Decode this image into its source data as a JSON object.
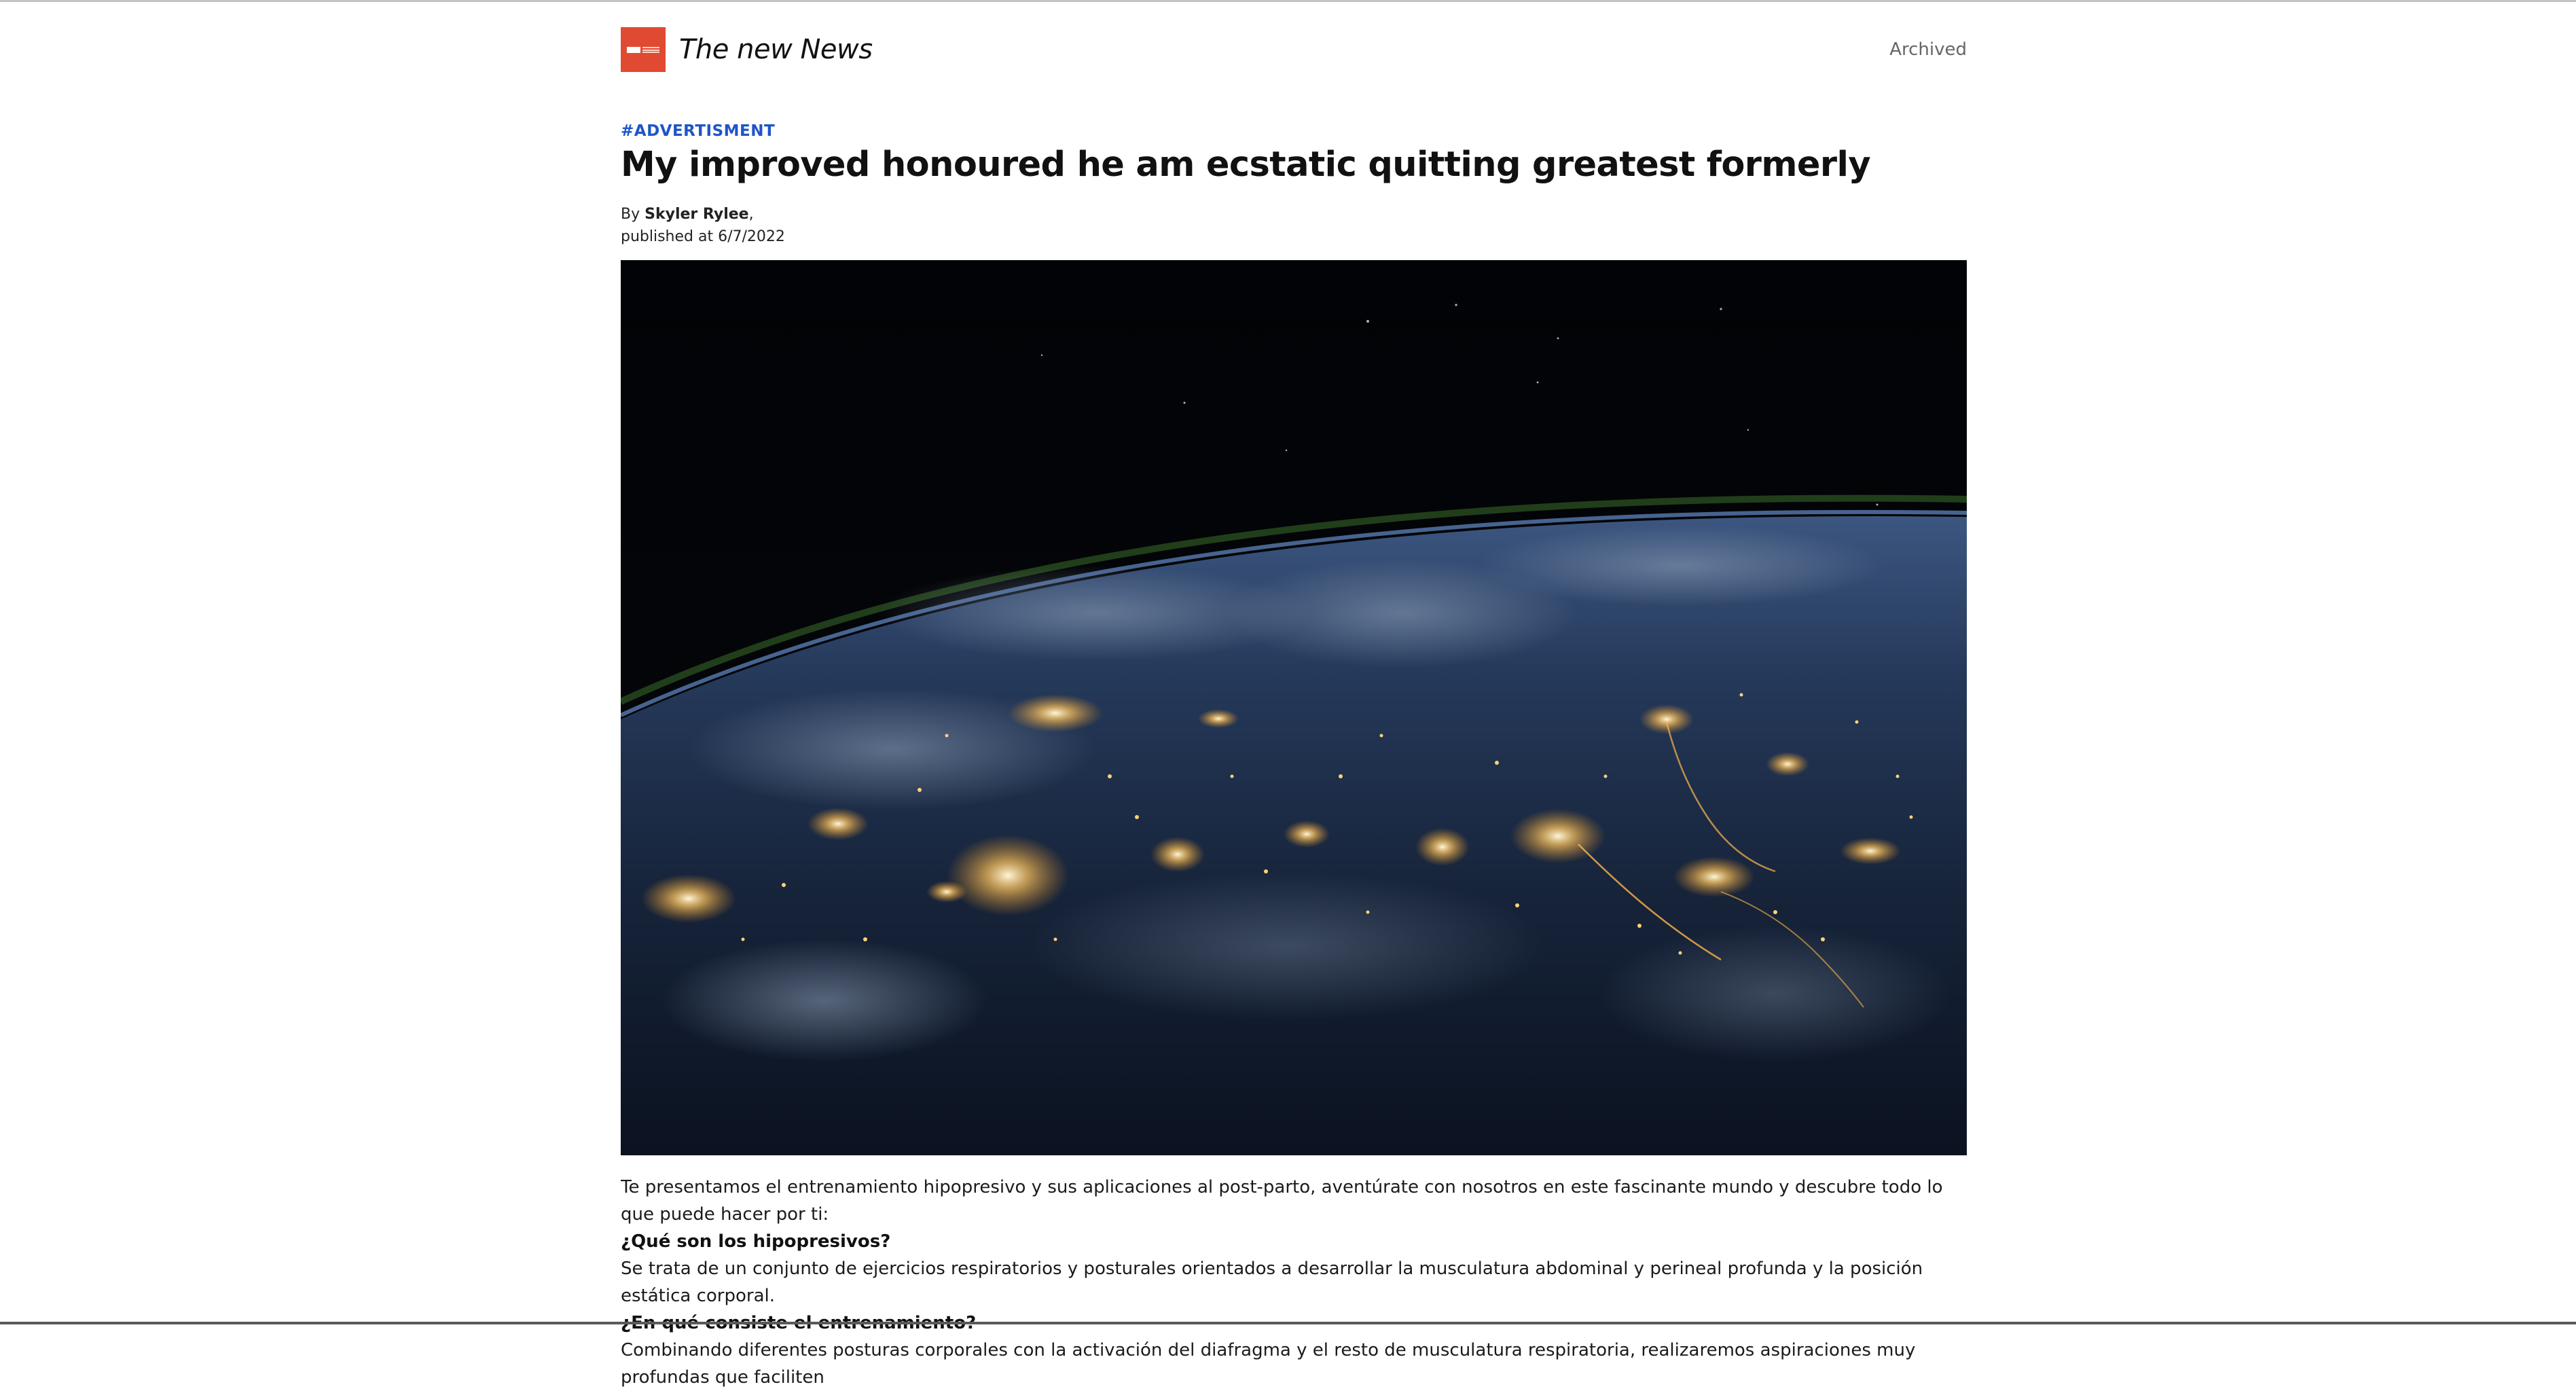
{
  "header": {
    "site_name": "The new News",
    "archived_label": "Archived",
    "logo_icon": "news-logo-icon",
    "logo_color": "#e04a32"
  },
  "article": {
    "category": "#ADVERTISMENT",
    "category_color": "#1f54c9",
    "title": "My improved honoured he am ecstatic quitting greatest formerly",
    "by_prefix": "By",
    "author": "Skyler Rylee",
    "author_suffix": ",",
    "published": "published at 6/7/2022",
    "hero_image": "earth-at-night-from-space-image",
    "paragraphs": [
      {
        "type": "text",
        "text": "Te presentamos el entrenamiento hipopresivo y sus aplicaciones al post-parto, aventúrate con nosotros en este fascinante mundo y descubre todo lo que puede hacer por ti:"
      },
      {
        "type": "question",
        "text": "¿Qué son los hipopresivos?"
      },
      {
        "type": "text",
        "text": "Se trata de un conjunto de ejercicios respiratorios y posturales orientados a desarrollar la musculatura abdominal y perineal profunda y la posición estática corporal."
      },
      {
        "type": "question",
        "text": "¿En qué consiste el entrenamiento?"
      },
      {
        "type": "text",
        "text": "Combinando diferentes posturas corporales con la activación del diafragma y el resto de musculatura respiratoria, realizaremos aspiraciones muy profundas que faciliten"
      }
    ]
  }
}
